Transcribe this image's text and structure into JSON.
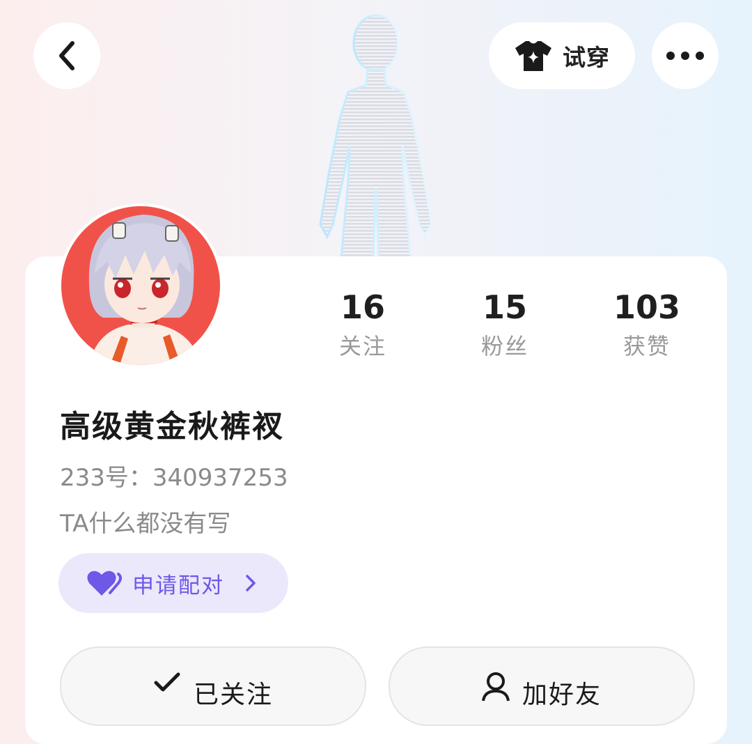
{
  "header": {
    "back_icon": "chevron-left-icon",
    "tryon_label": "试穿",
    "tryon_icon": "tshirt-sparkle-icon",
    "more_icon": "more-dots-icon"
  },
  "profile": {
    "name": "高级黄金秋裤衩",
    "uid_text": "233号：340937253",
    "bio": "TA什么都没有写"
  },
  "stats": [
    {
      "value": "16",
      "label": "关注"
    },
    {
      "value": "15",
      "label": "粉丝"
    },
    {
      "value": "103",
      "label": "获赞"
    }
  ],
  "match_button": {
    "label": "申请配对",
    "icon": "double-heart-icon",
    "accent": "#6d58e8",
    "background": "#ebe8fb"
  },
  "actions": [
    {
      "label": "已关注",
      "icon": "check-icon"
    },
    {
      "label": "加好友",
      "icon": "add-user-icon"
    }
  ],
  "avatar": {
    "background": "#f0524a"
  }
}
